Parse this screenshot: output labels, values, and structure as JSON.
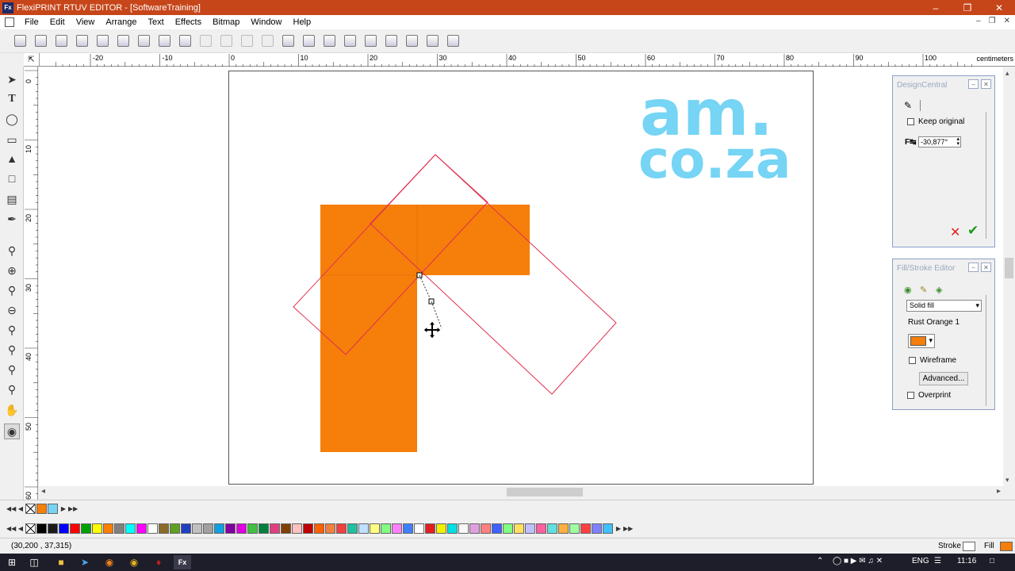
{
  "window": {
    "title": "FlexiPRINT RTUV EDITOR - [SoftwareTraining]",
    "logo": "Fx"
  },
  "menu": [
    "File",
    "Edit",
    "View",
    "Arrange",
    "Text",
    "Effects",
    "Bitmap",
    "Window",
    "Help"
  ],
  "toolbar_icons": [
    "new-file-icon",
    "open-file-icon",
    "save-icon",
    "save-as-icon",
    "print-icon",
    "print-setup-icon",
    "cut-icon",
    "copy-icon",
    "paste-icon",
    "undo-icon",
    "undo-all-icon",
    "redo-icon",
    "redo-all-icon",
    "arrange-icon",
    "align-icon",
    "import-icon",
    "color-wheel-icon",
    "color-picker-icon",
    "swatches-icon",
    "color-manager-icon",
    "cloud-icon",
    "upload-icon"
  ],
  "ruler_h": {
    "ticks": [
      "-20",
      "-10",
      "0",
      "10",
      "20",
      "30",
      "40",
      "50",
      "60",
      "70",
      "80",
      "90",
      "100"
    ],
    "unit": "centimeters"
  },
  "ruler_v": {
    "ticks": [
      "0",
      "10",
      "20",
      "30",
      "40",
      "50",
      "60"
    ]
  },
  "logo": {
    "line1": "am.",
    "line2": "co.za",
    "color": "#76d4f4"
  },
  "shape": {
    "fill_color": "#f57f0a",
    "outline_color": "#e03050"
  },
  "design_central": {
    "title": "DesignCentral",
    "keep_original": "Keep original",
    "angle_value": "-30,877°"
  },
  "fill_stroke": {
    "title": "Fill/Stroke Editor",
    "fill_type": "Solid fill",
    "color_name": "Rust Orange 1",
    "color": "#f57f0a",
    "wireframe": "Wireframe",
    "advanced": "Advanced...",
    "overprint": "Overprint"
  },
  "recent_swatches": [
    "#ffffff",
    "#f57f0a",
    "#76d4f4"
  ],
  "palette": [
    "#000000",
    "#1a1a1a",
    "#0000ff",
    "#ff0000",
    "#00a000",
    "#ffff00",
    "#ff8000",
    "#808080",
    "#00ffff",
    "#ff00ff",
    "#ffffff",
    "#8a6a2a",
    "#60a020",
    "#2040c0",
    "#c0c0c0",
    "#a0a0a0",
    "#10a0e0",
    "#8000a0",
    "#e000e0",
    "#40c040",
    "#008040",
    "#e04080",
    "#804000",
    "#ffc0c0",
    "#c00000",
    "#ff6000",
    "#f08040",
    "#f04040",
    "#20c0a0",
    "#c0e0ff",
    "#ffff80",
    "#80ff80",
    "#ff80ff",
    "#4080ff",
    "#ffffff",
    "#e02020",
    "#f0f000",
    "#00e0e0"
  ],
  "status": {
    "coords": "30,200 ,   37,315)",
    "coords_prefix": "(",
    "stroke": "Stroke",
    "fill": "Fill"
  },
  "taskbar": {
    "lang": "ENG",
    "time": "11:16"
  }
}
